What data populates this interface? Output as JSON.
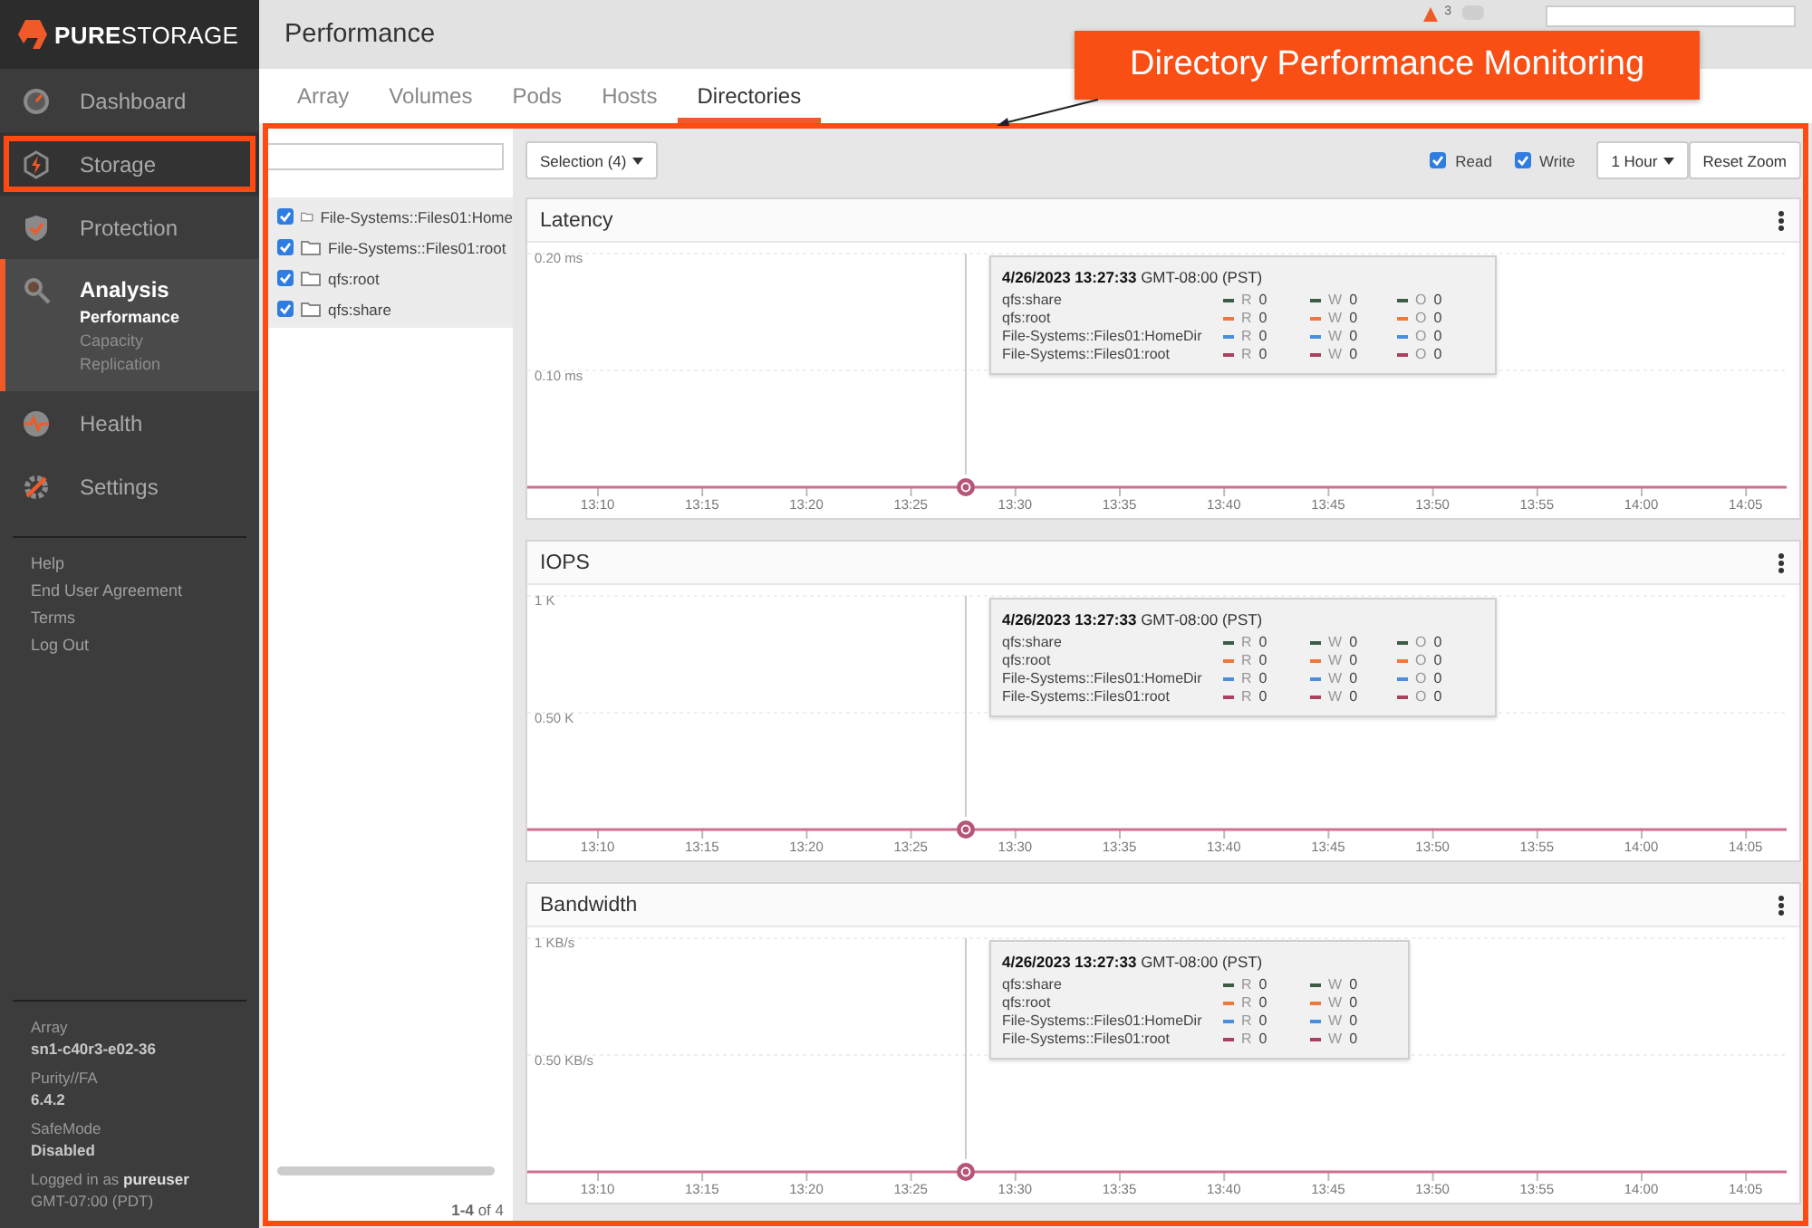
{
  "sidebar": {
    "logo": "**PURE**STORAGE",
    "items": [
      {
        "label": "Dashboard",
        "selected": false,
        "highlighted": false
      },
      {
        "label": "Storage",
        "selected": false,
        "highlighted": true
      },
      {
        "label": "Protection",
        "selected": false,
        "highlighted": false
      },
      {
        "label": "Analysis",
        "selected": true,
        "highlighted": false,
        "children": [
          {
            "label": "Performance",
            "selected": true
          },
          {
            "label": "Capacity",
            "selected": false
          },
          {
            "label": "Replication",
            "selected": false
          }
        ]
      },
      {
        "label": "Health",
        "selected": false,
        "highlighted": false
      },
      {
        "label": "Settings",
        "selected": false,
        "highlighted": false
      }
    ],
    "links": [
      "Help",
      "End User Agreement",
      "Terms",
      "Log Out"
    ],
    "info": [
      {
        "label": "Array",
        "value": "sn1-c40r3-e02-36"
      },
      {
        "label": "Purity//FA",
        "value": "6.4.2"
      },
      {
        "label": "SafeMode",
        "value": "Disabled"
      }
    ],
    "login": "Logged in as **pureuser**",
    "timezone": "GMT-07:00 (PDT)"
  },
  "header": {
    "title": "Performance",
    "alert_count": "3"
  },
  "tabs": [
    {
      "label": "Array",
      "selected": false
    },
    {
      "label": "Volumes",
      "selected": false
    },
    {
      "label": "Pods",
      "selected": false
    },
    {
      "label": "Hosts",
      "selected": false
    },
    {
      "label": "Directories",
      "selected": true
    }
  ],
  "directory_list": {
    "items": [
      {
        "label": "File-Systems::Files01:Home",
        "checked": true
      },
      {
        "label": "File-Systems::Files01:root",
        "checked": true
      },
      {
        "label": "qfs:root",
        "checked": true
      },
      {
        "label": "qfs:share",
        "checked": true
      }
    ],
    "pagination": "**1-4** of 4"
  },
  "toolbar": {
    "selection": "Selection (4)",
    "read": {
      "label": "Read",
      "checked": true
    },
    "write": {
      "label": "Write",
      "checked": true
    },
    "range": "1 Hour",
    "reset": "Reset Zoom"
  },
  "charts": [
    {
      "title": "Latency",
      "y_labels": [
        "0.20 ms",
        "0.10 ms"
      ],
      "x_labels": [
        "13:10",
        "13:15",
        "13:20",
        "13:25",
        "13:30",
        "13:35",
        "13:40",
        "13:45",
        "13:50",
        "13:55",
        "14:00",
        "14:05"
      ],
      "tooltip": {
        "time": "4/26/2023 13:27:33",
        "zone": "GMT-08:00 (PST)",
        "rows": [
          {
            "name": "qfs:share",
            "color": "#3d5c47",
            "metrics": [
              {
                "label": "R",
                "value": "0"
              },
              {
                "label": "W",
                "value": "0"
              },
              {
                "label": "O",
                "value": "0"
              }
            ]
          },
          {
            "name": "qfs:root",
            "color": "#f0783c",
            "metrics": [
              {
                "label": "R",
                "value": "0"
              },
              {
                "label": "W",
                "value": "0"
              },
              {
                "label": "O",
                "value": "0"
              }
            ]
          },
          {
            "name": "File-Systems::Files01:HomeDir",
            "color": "#4a8fdc",
            "metrics": [
              {
                "label": "R",
                "value": "0"
              },
              {
                "label": "W",
                "value": "0"
              },
              {
                "label": "O",
                "value": "0"
              }
            ]
          },
          {
            "name": "File-Systems::Files01:root",
            "color": "#a8425e",
            "metrics": [
              {
                "label": "R",
                "value": "0"
              },
              {
                "label": "W",
                "value": "0"
              },
              {
                "label": "O",
                "value": "0"
              }
            ]
          }
        ]
      }
    },
    {
      "title": "IOPS",
      "y_labels": [
        "1 K",
        "0.50 K"
      ],
      "x_labels": [
        "13:10",
        "13:15",
        "13:20",
        "13:25",
        "13:30",
        "13:35",
        "13:40",
        "13:45",
        "13:50",
        "13:55",
        "14:00",
        "14:05"
      ],
      "tooltip": {
        "time": "4/26/2023 13:27:33",
        "zone": "GMT-08:00 (PST)",
        "rows": [
          {
            "name": "qfs:share",
            "color": "#3d5c47",
            "metrics": [
              {
                "label": "R",
                "value": "0"
              },
              {
                "label": "W",
                "value": "0"
              },
              {
                "label": "O",
                "value": "0"
              }
            ]
          },
          {
            "name": "qfs:root",
            "color": "#f0783c",
            "metrics": [
              {
                "label": "R",
                "value": "0"
              },
              {
                "label": "W",
                "value": "0"
              },
              {
                "label": "O",
                "value": "0"
              }
            ]
          },
          {
            "name": "File-Systems::Files01:HomeDir",
            "color": "#4a8fdc",
            "metrics": [
              {
                "label": "R",
                "value": "0"
              },
              {
                "label": "W",
                "value": "0"
              },
              {
                "label": "O",
                "value": "0"
              }
            ]
          },
          {
            "name": "File-Systems::Files01:root",
            "color": "#a8425e",
            "metrics": [
              {
                "label": "R",
                "value": "0"
              },
              {
                "label": "W",
                "value": "0"
              },
              {
                "label": "O",
                "value": "0"
              }
            ]
          }
        ]
      }
    },
    {
      "title": "Bandwidth",
      "y_labels": [
        "1 KB/s",
        "0.50 KB/s"
      ],
      "x_labels": [
        "13:10",
        "13:15",
        "13:20",
        "13:25",
        "13:30",
        "13:35",
        "13:40",
        "13:45",
        "13:50",
        "13:55",
        "14:00",
        "14:05"
      ],
      "tooltip": {
        "time": "4/26/2023 13:27:33",
        "zone": "GMT-08:00 (PST)",
        "rows": [
          {
            "name": "qfs:share",
            "color": "#3d5c47",
            "metrics": [
              {
                "label": "R",
                "value": "0"
              },
              {
                "label": "W",
                "value": "0"
              }
            ]
          },
          {
            "name": "qfs:root",
            "color": "#f0783c",
            "metrics": [
              {
                "label": "R",
                "value": "0"
              },
              {
                "label": "W",
                "value": "0"
              }
            ]
          },
          {
            "name": "File-Systems::Files01:HomeDir",
            "color": "#4a8fdc",
            "metrics": [
              {
                "label": "R",
                "value": "0"
              },
              {
                "label": "W",
                "value": "0"
              }
            ]
          },
          {
            "name": "File-Systems::Files01:root",
            "color": "#a8425e",
            "metrics": [
              {
                "label": "R",
                "value": "0"
              },
              {
                "label": "W",
                "value": "0"
              }
            ]
          }
        ]
      }
    }
  ],
  "annotation": {
    "label": "Directory Performance Monitoring"
  }
}
